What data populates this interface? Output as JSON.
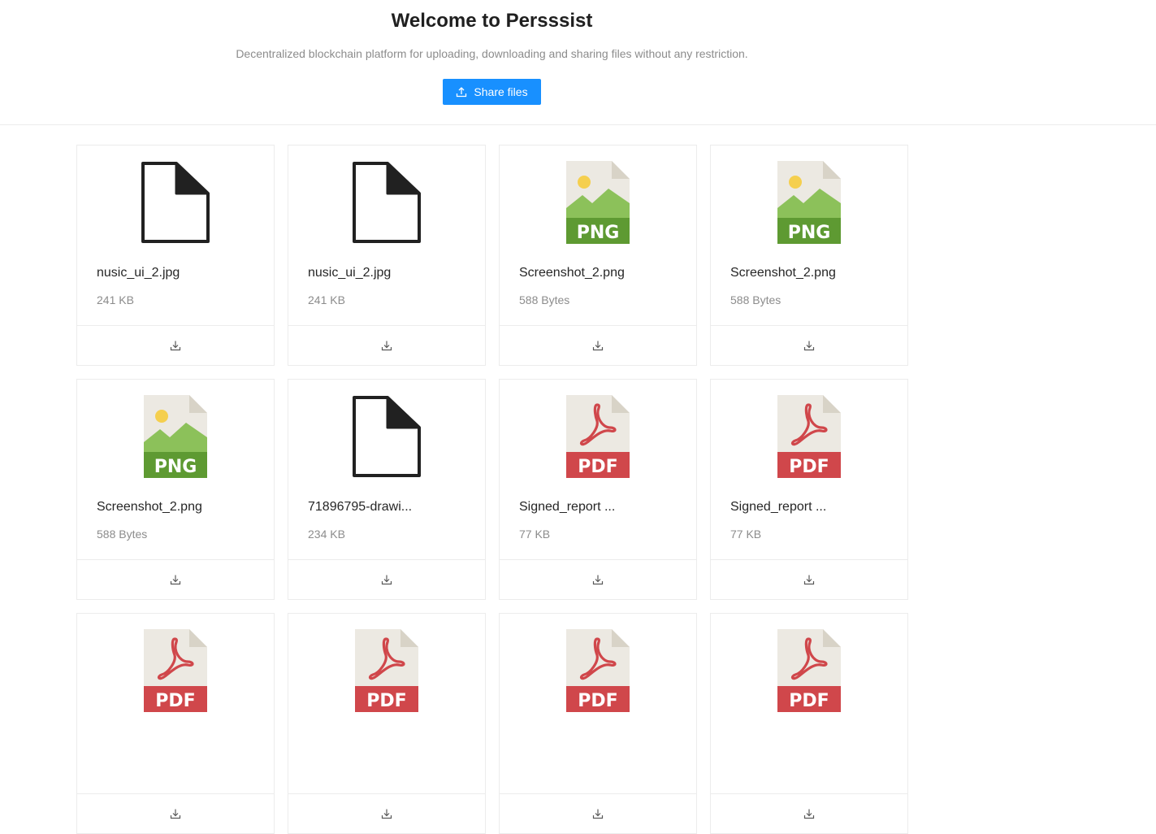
{
  "header": {
    "title": "Welcome to Persssist",
    "subtitle": "Decentralized blockchain platform for uploading, downloading and sharing files without any restriction.",
    "share_label": "Share files"
  },
  "colors": {
    "primary": "#1890ff",
    "png_green": "#6aa338",
    "pdf_red": "#d0474b",
    "file_bg": "#ece9e2"
  },
  "files": [
    {
      "name": "nusic_ui_2.jpg",
      "size": "241 KB",
      "icon": "generic-file-icon"
    },
    {
      "name": "nusic_ui_2.jpg",
      "size": "241 KB",
      "icon": "generic-file-icon"
    },
    {
      "name": "Screenshot_2.png",
      "size": "588 Bytes",
      "icon": "png-file-icon"
    },
    {
      "name": "Screenshot_2.png",
      "size": "588 Bytes",
      "icon": "png-file-icon"
    },
    {
      "name": "Screenshot_2.png",
      "size": "588 Bytes",
      "icon": "png-file-icon"
    },
    {
      "name": "71896795-drawi...",
      "size": "234 KB",
      "icon": "generic-file-icon"
    },
    {
      "name": "Signed_report ...",
      "size": "77 KB",
      "icon": "pdf-file-icon"
    },
    {
      "name": "Signed_report ...",
      "size": "77 KB",
      "icon": "pdf-file-icon"
    },
    {
      "name": "",
      "size": "",
      "icon": "pdf-file-icon"
    },
    {
      "name": "",
      "size": "",
      "icon": "pdf-file-icon"
    },
    {
      "name": "",
      "size": "",
      "icon": "pdf-file-icon"
    },
    {
      "name": "",
      "size": "",
      "icon": "pdf-file-icon"
    }
  ]
}
